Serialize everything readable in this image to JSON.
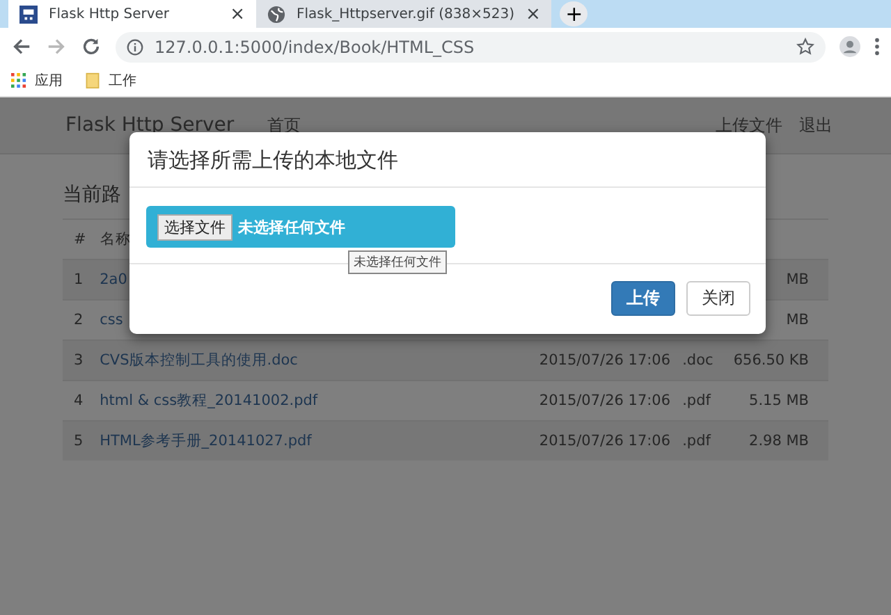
{
  "browser": {
    "tabs": [
      {
        "title": "Flask Http Server",
        "selected": true,
        "close": "×"
      },
      {
        "title": "Flask_Httpserver.gif (838×523)",
        "selected": false,
        "close": "×"
      }
    ],
    "new_tab": "+",
    "url": "127.0.0.1:5000/index/Book/HTML_CSS",
    "bookmarks": [
      {
        "label": "应用",
        "kind": "apps"
      },
      {
        "label": "工作",
        "kind": "folder"
      }
    ]
  },
  "navbar": {
    "brand": "Flask Http Server",
    "links": [
      "首页"
    ],
    "right_links": [
      "上传文件",
      "退出"
    ]
  },
  "path_heading": "当前路",
  "table": {
    "columns": [
      "#",
      "名称"
    ],
    "rows": [
      {
        "cells": [
          "1",
          "2a0",
          "",
          "",
          "MB"
        ]
      },
      {
        "cells": [
          "2",
          "css",
          "",
          "",
          "MB"
        ]
      },
      {
        "cells": [
          "3",
          "CVS版本控制工具的使用.doc",
          "2015/07/26 17:06",
          ".doc",
          "656.50 KB"
        ]
      },
      {
        "cells": [
          "4",
          "html & css教程_20141002.pdf",
          "2015/07/26 17:06",
          ".pdf",
          "5.15 MB"
        ]
      },
      {
        "cells": [
          "5",
          "HTML参考手册_20141027.pdf",
          "2015/07/26 17:06",
          ".pdf",
          "2.98 MB"
        ]
      }
    ]
  },
  "modal": {
    "title": "请选择所需上传的本地文件",
    "file_button": "选择文件",
    "file_status": "未选择任何文件",
    "tooltip": "未选择任何文件",
    "buttons": [
      {
        "label": "上传",
        "kind": "primary"
      },
      {
        "label": "关闭",
        "kind": "default"
      }
    ]
  }
}
